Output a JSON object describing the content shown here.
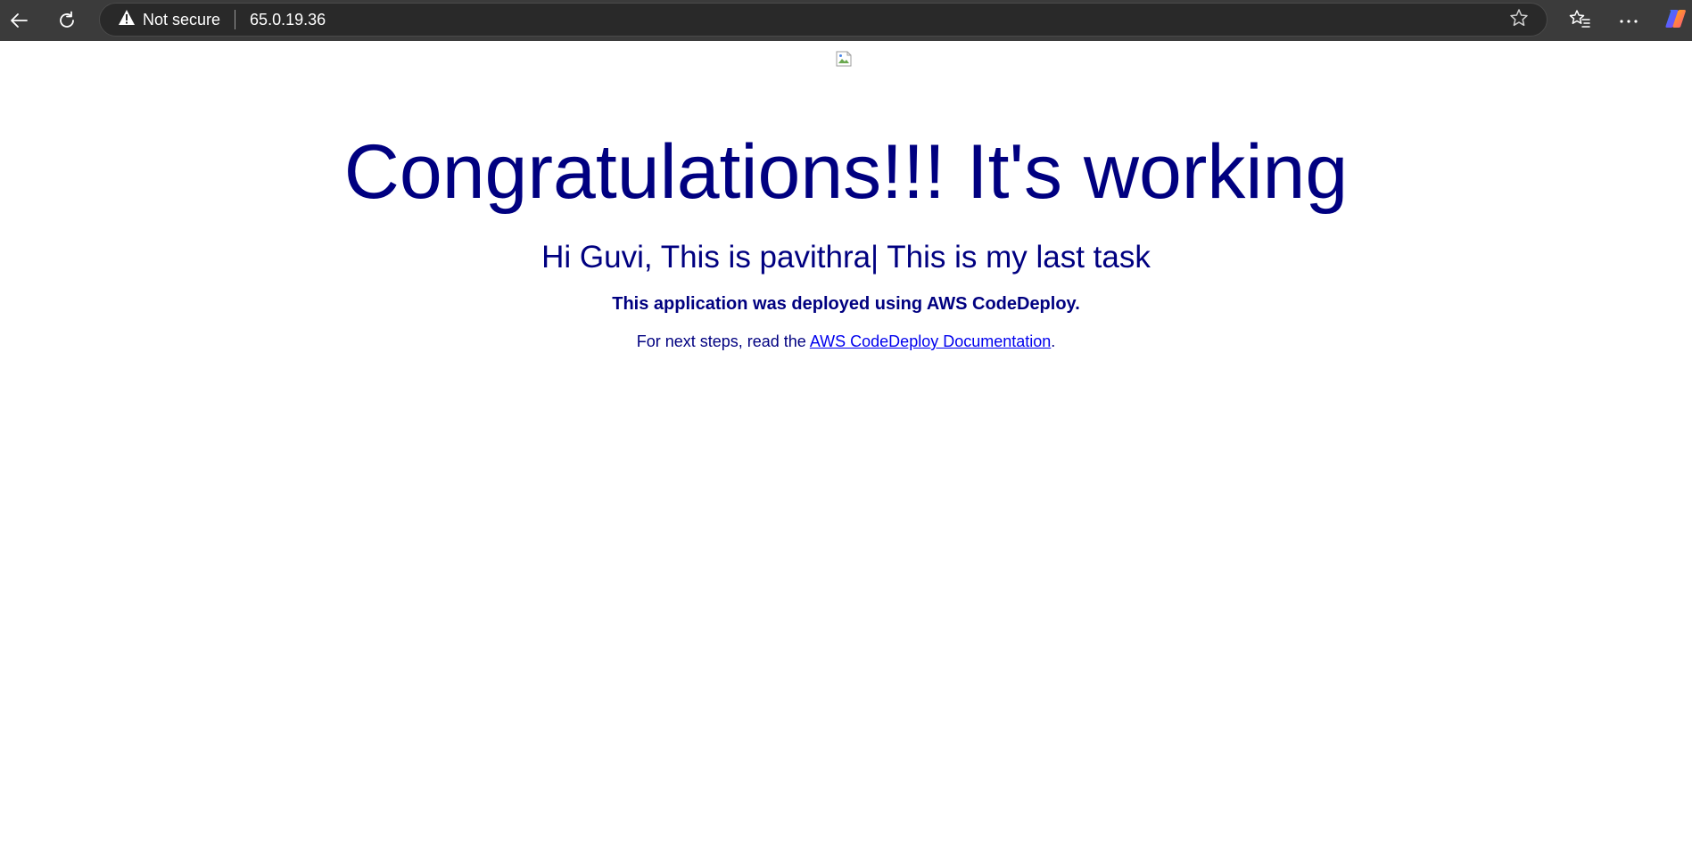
{
  "browser": {
    "security_label": "Not secure",
    "url": "65.0.19.36",
    "icons": {
      "back": "back-arrow-icon",
      "reload": "reload-icon",
      "security": "warning-triangle-icon",
      "favorite": "star-icon",
      "favorites": "favorites-list-icon",
      "menu": "more-ellipsis-icon",
      "copilot": "copilot-icon"
    }
  },
  "page": {
    "headline": "Congratulations!!! It's working",
    "subhead": "Hi Guvi, This is pavithra| This is my last task",
    "deploy_note": "This application was deployed using AWS CodeDeploy.",
    "next_steps_prefix": "For next steps, read the ",
    "doc_link_text": "AWS CodeDeploy Documentation",
    "next_steps_suffix": "."
  },
  "colors": {
    "text": "#000080",
    "link": "#0000ee",
    "toolbar": "#3b3b3b"
  }
}
